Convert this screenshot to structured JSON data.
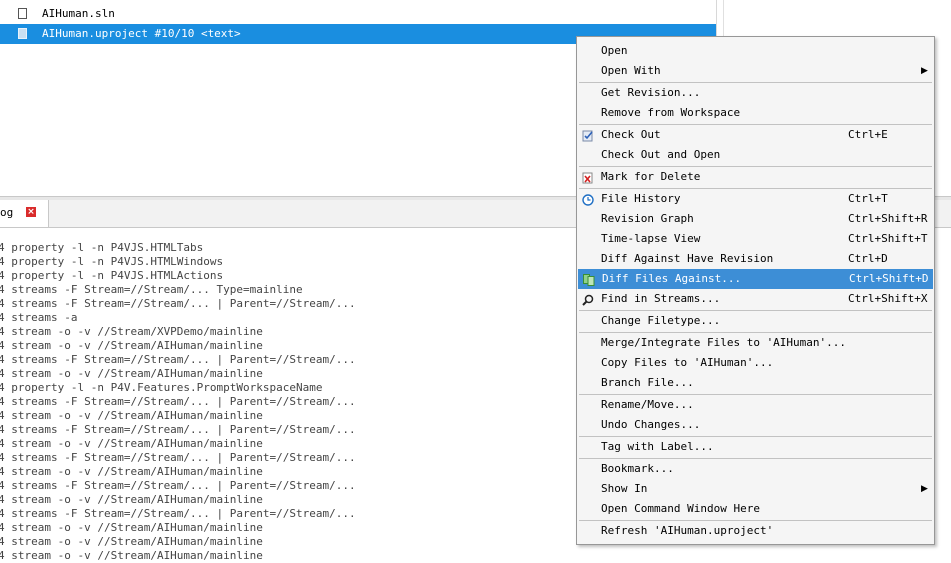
{
  "files": [
    {
      "name": "AIHuman.sln",
      "selected": false
    },
    {
      "name": "AIHuman.uproject #10/10 <text>",
      "selected": true
    }
  ],
  "log_tab": {
    "label": "og",
    "close_glyph": "×"
  },
  "log_lines": [
    "4 property -l -n P4VJS.HTMLTabs",
    "4 property -l -n P4VJS.HTMLWindows",
    "4 property -l -n P4VJS.HTMLActions",
    "4 streams -F Stream=//Stream/... Type=mainline",
    "4 streams -F Stream=//Stream/... | Parent=//Stream/...",
    "4 streams -a",
    "4 stream -o -v //Stream/XVPDemo/mainline",
    "4 stream -o -v //Stream/AIHuman/mainline",
    "4 streams -F Stream=//Stream/... | Parent=//Stream/...",
    "4 stream -o -v //Stream/AIHuman/mainline",
    "4 property -l -n P4V.Features.PromptWorkspaceName",
    "4 streams -F Stream=//Stream/... | Parent=//Stream/...",
    "4 stream -o -v //Stream/AIHuman/mainline",
    "4 streams -F Stream=//Stream/... | Parent=//Stream/...",
    "4 stream -o -v //Stream/AIHuman/mainline",
    "4 streams -F Stream=//Stream/... | Parent=//Stream/...",
    "4 stream -o -v //Stream/AIHuman/mainline",
    "4 streams -F Stream=//Stream/... | Parent=//Stream/...",
    "4 stream -o -v //Stream/AIHuman/mainline",
    "4 streams -F Stream=//Stream/... | Parent=//Stream/...",
    "4 stream -o -v //Stream/AIHuman/mainline",
    "4 stream -o -v //Stream/AIHuman/mainline",
    "4 stream -o -v //Stream/AIHuman/mainline"
  ],
  "context_menu": {
    "items": [
      {
        "label": "Open",
        "name": "menu-item-open"
      },
      {
        "label": "Open With",
        "name": "menu-item-open-with",
        "submenu": true
      },
      {
        "label": "Get Revision...",
        "name": "menu-item-get-revision",
        "sep_before": true
      },
      {
        "label": "Remove from Workspace",
        "name": "menu-item-remove-from-workspace"
      },
      {
        "label": "Check Out",
        "name": "menu-item-check-out",
        "shortcut": "Ctrl+E",
        "icon": "checkout-icon",
        "sep_before": true
      },
      {
        "label": "Check Out and Open",
        "name": "menu-item-check-out-and-open"
      },
      {
        "label": "Mark for Delete",
        "name": "menu-item-mark-for-delete",
        "icon": "delete-mark-icon",
        "sep_before": true
      },
      {
        "label": "File History",
        "name": "menu-item-file-history",
        "shortcut": "Ctrl+T",
        "icon": "history-clock-icon",
        "sep_before": true
      },
      {
        "label": "Revision Graph",
        "name": "menu-item-revision-graph",
        "shortcut": "Ctrl+Shift+R"
      },
      {
        "label": "Time-lapse View",
        "name": "menu-item-time-lapse-view",
        "shortcut": "Ctrl+Shift+T"
      },
      {
        "label": "Diff Against Have Revision",
        "name": "menu-item-diff-against-have",
        "shortcut": "Ctrl+D"
      },
      {
        "label": "Diff Files Against...",
        "name": "menu-item-diff-files-against",
        "shortcut": "Ctrl+Shift+D",
        "icon": "diff-icon",
        "active": true
      },
      {
        "label": "Find in Streams...",
        "name": "menu-item-find-in-streams",
        "shortcut": "Ctrl+Shift+X",
        "icon": "search-icon"
      },
      {
        "label": "Change Filetype...",
        "name": "menu-item-change-filetype",
        "sep_before": true
      },
      {
        "label": "Merge/Integrate Files to 'AIHuman'...",
        "name": "menu-item-merge-integrate",
        "sep_before": true
      },
      {
        "label": "Copy Files to 'AIHuman'...",
        "name": "menu-item-copy-files"
      },
      {
        "label": "Branch File...",
        "name": "menu-item-branch-file"
      },
      {
        "label": "Rename/Move...",
        "name": "menu-item-rename-move",
        "sep_before": true
      },
      {
        "label": "Undo Changes...",
        "name": "menu-item-undo-changes"
      },
      {
        "label": "Tag with Label...",
        "name": "menu-item-tag-with-label",
        "sep_before": true
      },
      {
        "label": "Bookmark...",
        "name": "menu-item-bookmark",
        "sep_before": true
      },
      {
        "label": "Show In",
        "name": "menu-item-show-in",
        "submenu": true
      },
      {
        "label": "Open Command Window Here",
        "name": "menu-item-open-command-window"
      },
      {
        "label": "Refresh 'AIHuman.uproject'",
        "name": "menu-item-refresh",
        "sep_before": true
      }
    ],
    "submenu_arrow": "▶"
  },
  "colors": {
    "selection": "#1a8ee0",
    "menu_highlight": "#3d8ed6",
    "tab_close": "#d92b2b"
  }
}
